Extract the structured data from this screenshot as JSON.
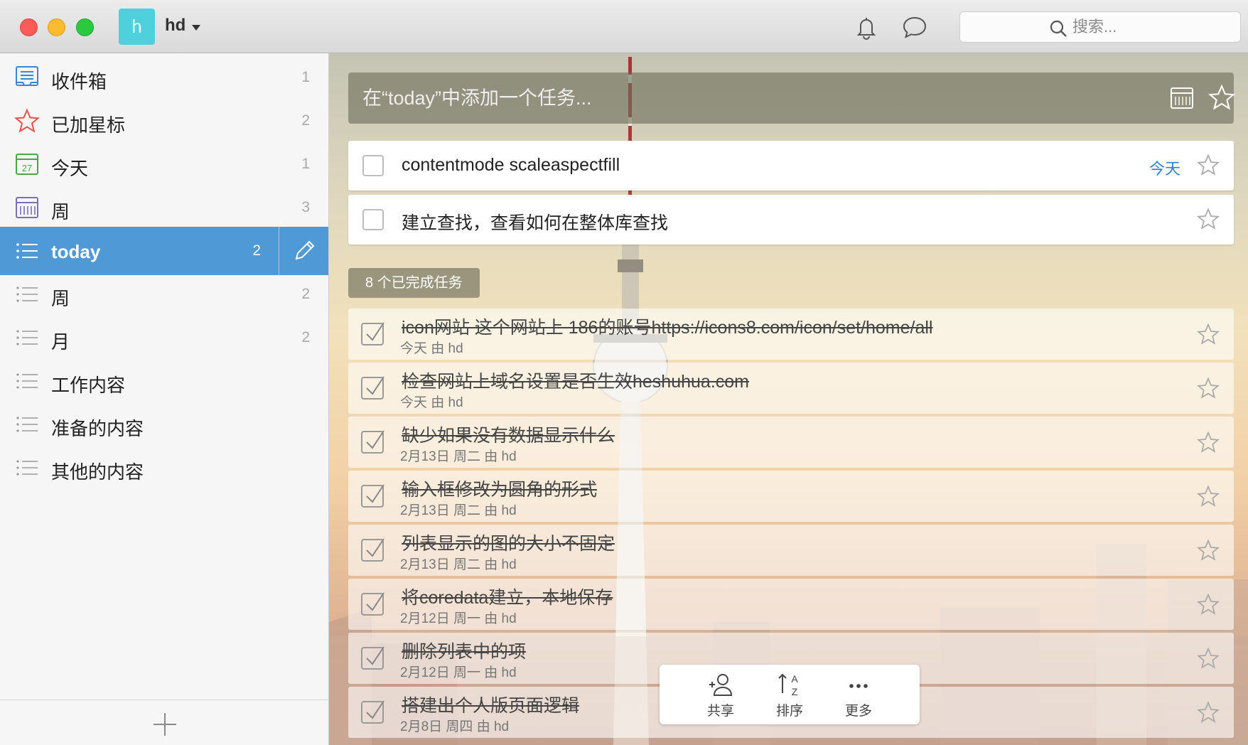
{
  "user": {
    "avatar_letter": "h",
    "name": "hd"
  },
  "search": {
    "placeholder": "搜索..."
  },
  "sidebar": {
    "items": [
      {
        "label": "收件箱",
        "count": "1",
        "icon": "inbox-icon"
      },
      {
        "label": "已加星标",
        "count": "2",
        "icon": "star-icon"
      },
      {
        "label": "今天",
        "count": "1",
        "icon": "calendar-today-icon",
        "calendar_day": "27"
      },
      {
        "label": "周",
        "count": "3",
        "icon": "calendar-week-icon"
      },
      {
        "label": "today",
        "count": "2",
        "icon": "list-icon",
        "active": true
      },
      {
        "label": "周",
        "count": "2",
        "icon": "list-icon"
      },
      {
        "label": "月",
        "count": "2",
        "icon": "list-icon"
      },
      {
        "label": "工作内容",
        "count": "",
        "icon": "list-icon"
      },
      {
        "label": "准备的内容",
        "count": "",
        "icon": "list-icon"
      },
      {
        "label": "其他的内容",
        "count": "",
        "icon": "list-icon"
      }
    ]
  },
  "add_task": {
    "placeholder": "在“today”中添加一个任务..."
  },
  "tasks": [
    {
      "title": "contentmode scaleaspectfill",
      "due": "今天"
    },
    {
      "title": "建立查找，查看如何在整体库查找",
      "due": ""
    }
  ],
  "completed_badge": "8 个已完成任务",
  "completed": [
    {
      "title": "icon网站 这个网站上 186的账号https://icons8.com/icon/set/home/all",
      "meta": "今天 由 hd"
    },
    {
      "title": "检查网站上域名设置是否生效heshuhua.com",
      "meta": "今天 由 hd"
    },
    {
      "title": "缺少如果没有数据显示什么",
      "meta": "2月13日 周二 由 hd"
    },
    {
      "title": "输入框修改为圆角的形式",
      "meta": "2月13日 周二 由 hd"
    },
    {
      "title": "列表显示的图的大小不固定",
      "meta": "2月13日 周二 由 hd"
    },
    {
      "title": "将coredata建立，本地保存",
      "meta": "2月12日 周一 由 hd"
    },
    {
      "title": "删除列表中的项",
      "meta": "2月12日 周一 由 hd"
    },
    {
      "title": "搭建出个人版页面逻辑",
      "meta": "2月8日 周四 由 hd"
    }
  ],
  "toolbar": {
    "share": "共享",
    "sort": "排序",
    "more": "更多"
  },
  "colors": {
    "accent": "#4f9ad6",
    "due_blue": "#2f7fd0",
    "avatar": "#4fd0dd"
  }
}
